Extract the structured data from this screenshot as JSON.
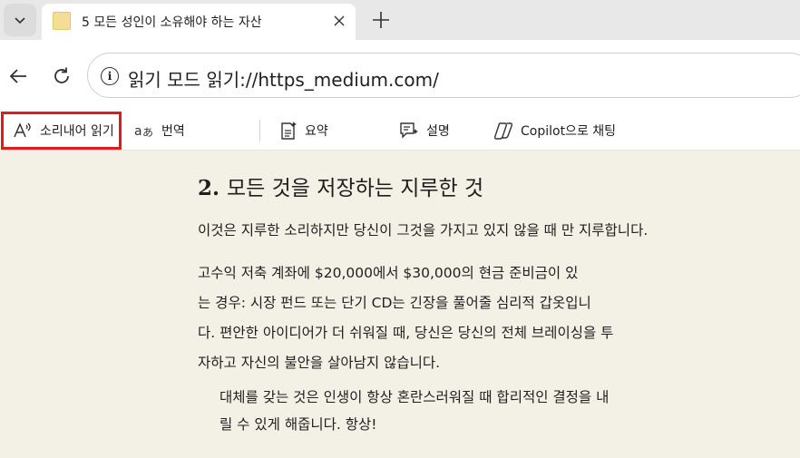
{
  "tab": {
    "title": "5 모든 성인이 소유해야 하는 자산"
  },
  "address_bar": {
    "url": "읽기 모드 읽기://https_medium.com/"
  },
  "reader_toolbar": {
    "read_aloud": "소리내어 읽기",
    "translate": "번역",
    "summarize": "요약",
    "explain": "설명",
    "copilot_chat": "Copilot으로 채팅"
  },
  "article": {
    "heading_number": "2.",
    "heading_text": "모든 것을 저장하는 지루한 것",
    "paragraph1": "이것은 지루한 소리하지만 당신이 그것을 가지고 있지 않을 때 만 지루합니다.",
    "paragraph2_lines": [
      "고수익 저축 계좌에 $20,000에서 $30,000의 현금 준비금이 있",
      "는 경우: 시장 펀드 또는 단기 CD는 긴장을 풀어줄 심리적 갑옷입니",
      "다. 편안한 아이디어가 더 쉬워질 때, 당신은 당신의 전체 브레이싱을 투",
      "자하고 자신의 불안을 살아남지 않습니다."
    ],
    "quote_lines": [
      "대체를 갖는 것은 인생이 항상 혼란스러워질 때 합리적인 결정을 내",
      "릴 수 있게 해줍니다. 항상!"
    ]
  },
  "colors": {
    "reader_background": "#f3f1e6",
    "highlight_border": "#e01b1b"
  }
}
